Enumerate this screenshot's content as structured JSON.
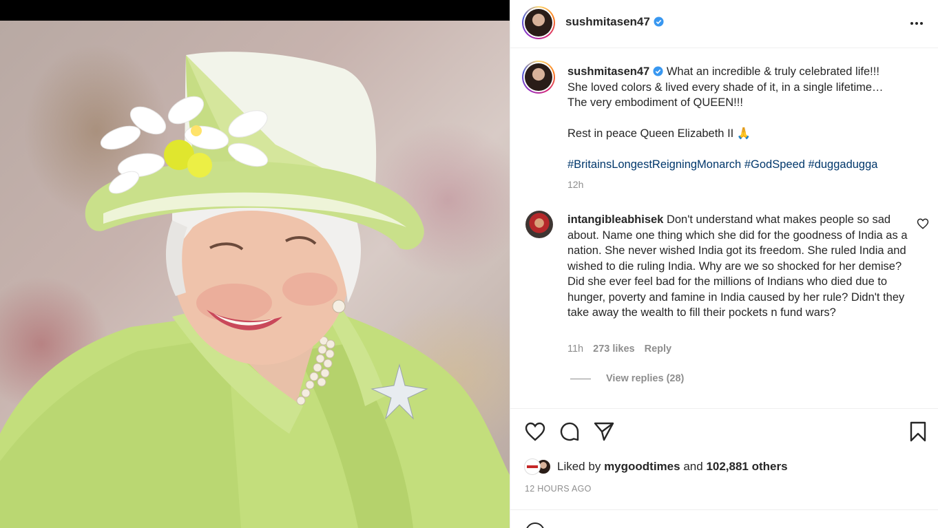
{
  "post": {
    "username": "sushmitasen47",
    "caption_lines": [
      "What an incredible & truly celebrated life!!!",
      "She loved colors & lived every shade of it, in a single lifetime…",
      "The very embodiment of QUEEN!!!",
      "Rest in peace Queen Elizabeth II 🙏"
    ],
    "hashtags": [
      "#BritainsLongestReigningMonarch",
      "#GodSpeed",
      "#duggadugga"
    ],
    "caption_time": "12h",
    "timestamp": "12 HOURS AGO"
  },
  "comment": {
    "username": "intangibleabhisek",
    "text": "Don't understand what makes people so sad about. Name one thing which she did for the goodness of India as a nation. She never wished India got its freedom. She ruled India and wished to die ruling India. Why are we so shocked for her demise? Did she ever feel bad for the millions of Indians who died due to hunger, poverty and famine in India caused by her rule? Didn't they take away the wealth to fill their pockets n fund wars?",
    "time": "11h",
    "likes": "273 likes",
    "reply_label": "Reply",
    "view_replies": "View replies (28)"
  },
  "likes": {
    "prefix": "Liked by",
    "user": "mygoodtimes",
    "and": "and",
    "others": "102,881 others"
  },
  "icons": [
    "more-icon",
    "verified-icon",
    "heart-icon",
    "comment-icon",
    "share-icon",
    "save-icon",
    "emoji-icon"
  ],
  "colors": {
    "link": "#00376b",
    "muted": "#8e8e8e",
    "verified": "#3897f0"
  }
}
